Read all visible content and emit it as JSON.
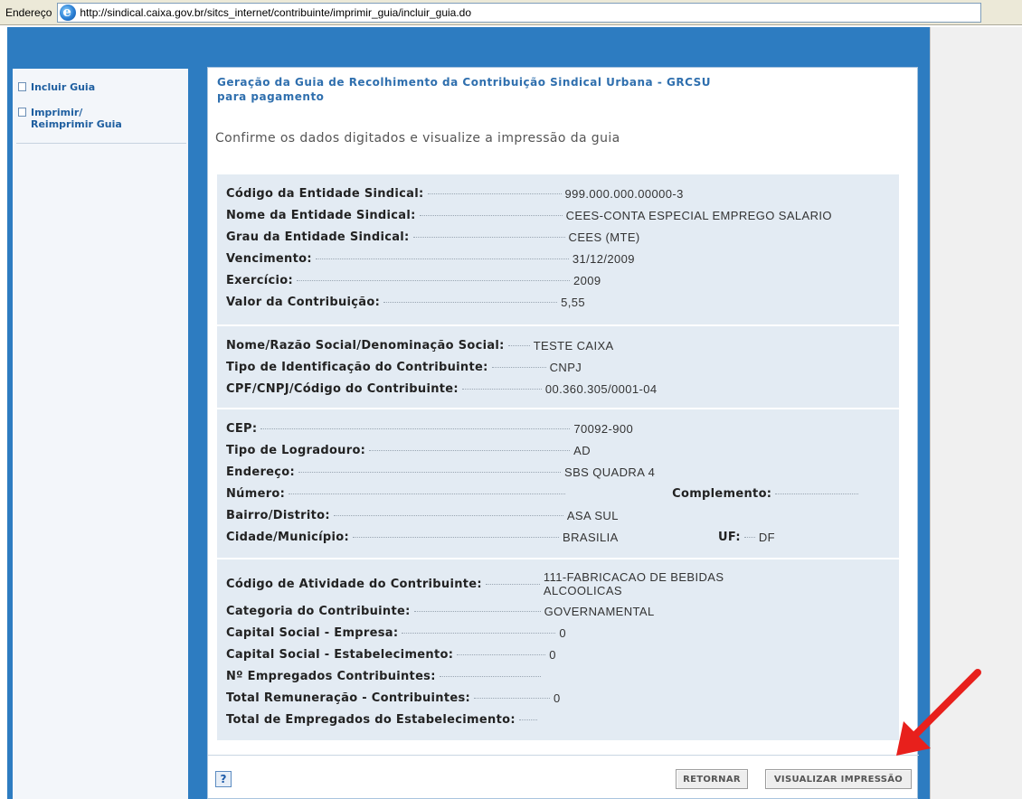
{
  "address_bar": {
    "label": "Endereço",
    "url": "http://sindical.caixa.gov.br/sitcs_internet/contribuinte/imprimir_guia/incluir_guia.do"
  },
  "sidebar": {
    "items": [
      {
        "label": "Incluir Guia"
      },
      {
        "label_line1": "Imprimir/",
        "label_line2": "Reimprimir Guia"
      }
    ]
  },
  "main": {
    "title_line1": "Geração da Guia de Recolhimento da Contribuição Sindical Urbana - GRCSU",
    "title_line2": "para pagamento",
    "subtitle": "Confirme os dados digitados e visualize a impressão da guia",
    "section1": [
      {
        "label": "Código da Entidade Sindical:",
        "value": "999.000.000.00000-3"
      },
      {
        "label": "Nome da Entidade Sindical:",
        "value": "CEES-CONTA ESPECIAL EMPREGO SALARIO"
      },
      {
        "label": "Grau da Entidade Sindical:",
        "value": "CEES (MTE)"
      },
      {
        "label": "Vencimento:",
        "value": "31/12/2009"
      },
      {
        "label": "Exercício:",
        "value": "2009"
      },
      {
        "label": "Valor da Contribuição:",
        "value": "5,55"
      }
    ],
    "section2": [
      {
        "label": "Nome/Razão Social/Denominação Social:",
        "value": "TESTE CAIXA"
      },
      {
        "label": "Tipo de Identificação do Contribuinte:",
        "value": "CNPJ"
      },
      {
        "label": "CPF/CNPJ/Código do Contribuinte:",
        "value": "00.360.305/0001-04"
      }
    ],
    "section3": {
      "cep": {
        "label": "CEP:",
        "value": "70092-900"
      },
      "tipo_logradouro": {
        "label": "Tipo de Logradouro:",
        "value": "AD"
      },
      "endereco": {
        "label": "Endereço:",
        "value": "SBS QUADRA 4"
      },
      "numero": {
        "label": "Número:",
        "value": ""
      },
      "complemento": {
        "label": "Complemento:",
        "value": ""
      },
      "bairro": {
        "label": "Bairro/Distrito:",
        "value": "ASA SUL"
      },
      "cidade": {
        "label": "Cidade/Município:",
        "value": "BRASILIA"
      },
      "uf": {
        "label": "UF:",
        "value": "DF"
      }
    },
    "section4": {
      "atividade": {
        "label": "Código de Atividade do Contribuinte:",
        "value_line1": "111-FABRICACAO DE BEBIDAS",
        "value_line2": "ALCOOLICAS"
      },
      "categoria": {
        "label": "Categoria do Contribuinte:",
        "value": "GOVERNAMENTAL"
      },
      "capital_empresa": {
        "label": "Capital Social - Empresa:",
        "value": "0"
      },
      "capital_estab": {
        "label": "Capital Social - Estabelecimento:",
        "value": "0"
      },
      "empregados": {
        "label": "Nº Empregados Contribuintes:",
        "value": ""
      },
      "remuneracao": {
        "label": "Total Remuneração - Contribuintes:",
        "value": "0"
      },
      "total_empregados": {
        "label": "Total de Empregados do Estabelecimento:",
        "value": ""
      }
    }
  },
  "footer": {
    "help_label": "?",
    "retornar_label": "RETORNAR",
    "visualizar_label": "VISUALIZAR IMPRESSÃO"
  },
  "colors": {
    "app_background": "#2d7cc1",
    "data_box": "#e3ebf3",
    "title": "#2f6fae",
    "arrow": "#e8201c"
  }
}
